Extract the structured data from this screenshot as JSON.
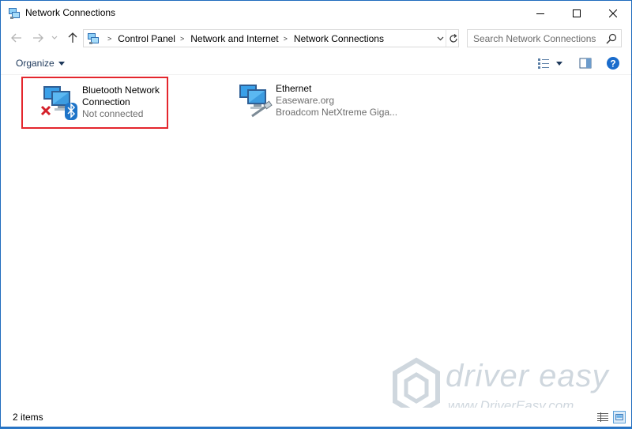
{
  "window": {
    "title": "Network Connections",
    "icon": "network-connections-icon"
  },
  "titlebar_buttons": {
    "minimize": "minimize-icon",
    "maximize": "maximize-icon",
    "close": "close-icon"
  },
  "address": {
    "breadcrumbs": [
      "Control Panel",
      "Network and Internet",
      "Network Connections"
    ],
    "separator": ">"
  },
  "search": {
    "placeholder": "Search Network Connections"
  },
  "toolbar": {
    "organize_label": "Organize"
  },
  "connections": [
    {
      "name_line1": "Bluetooth Network",
      "name_line2": "Connection",
      "status": "Not connected",
      "icon": "bluetooth-network-icon",
      "highlighted": true,
      "highlight_color": "#e4262d"
    },
    {
      "name": "Ethernet",
      "network": "Easeware.org",
      "adapter": "Broadcom NetXtreme Giga..."
    }
  ],
  "statusbar": {
    "item_count": "2 items"
  },
  "watermark": {
    "brand": "driver easy",
    "url": "www.DriverEasy.com"
  },
  "colors": {
    "accent": "#1f6bbd",
    "highlight": "#e4262d",
    "link_text": "#1e395b",
    "muted_text": "#6d6d6d"
  }
}
